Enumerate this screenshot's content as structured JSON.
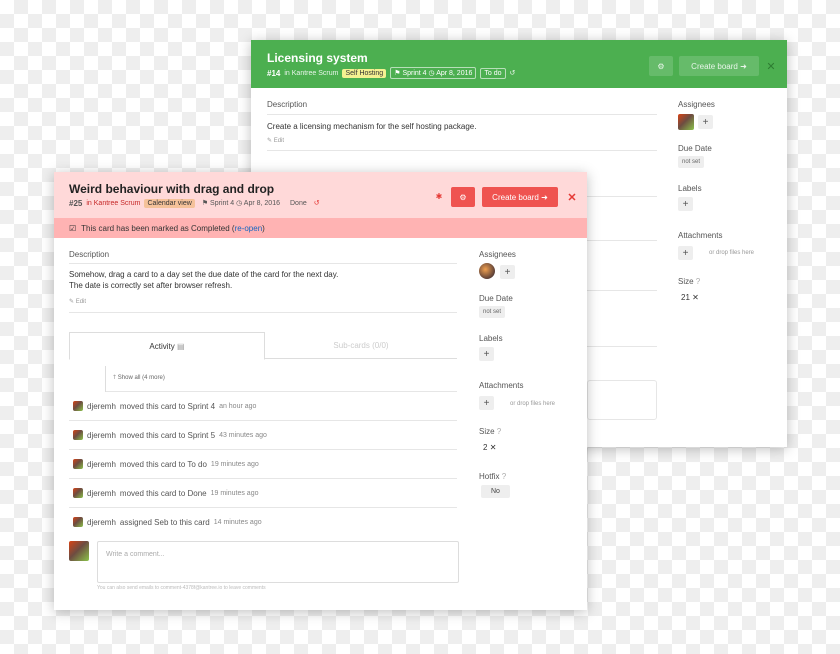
{
  "back_card": {
    "title": "Licensing system",
    "number": "#14",
    "in_label": "in Kantree Scrum",
    "tag": "Self Hosting",
    "sprint": "Sprint 4",
    "date": "Apr 8, 2016",
    "status": "To do",
    "create_board_label": "Create board",
    "description_label": "Description",
    "description_text": "Create a licensing mechanism for the self hosting package.",
    "edit_label": "Edit",
    "sidebar": {
      "assignees_label": "Assignees",
      "due_date_label": "Due Date",
      "due_date_value": "not set",
      "labels_label": "Labels",
      "attachments_label": "Attachments",
      "drop_hint": "or drop files here",
      "size_label": "Size",
      "size_value": "21"
    }
  },
  "front_card": {
    "title": "Weird behaviour with drag and drop",
    "number": "#25",
    "in_label": "in Kantree Scrum",
    "tag": "Calendar view",
    "sprint": "Sprint 4",
    "date": "Apr 8, 2016",
    "status": "Done",
    "create_board_label": "Create board",
    "banner_text": "This card has been marked as Completed (",
    "banner_link": "re-open",
    "banner_close": ")",
    "description_label": "Description",
    "description_line1": "Somehow, drag a card to a day set the due date of the card for the next day.",
    "description_line2": "The date is correctly set after browser refresh.",
    "edit_label": "Edit",
    "tabs": {
      "activity": "Activity",
      "subcards": "Sub-cards (0/0)"
    },
    "show_all": "Show all (4 more)",
    "activity": [
      {
        "user": "djeremh",
        "action": "moved this card to Sprint 4",
        "time": "an hour ago"
      },
      {
        "user": "djeremh",
        "action": "moved this card to Sprint 5",
        "time": "43 minutes ago"
      },
      {
        "user": "djeremh",
        "action": "moved this card to To do",
        "time": "19 minutes ago"
      },
      {
        "user": "djeremh",
        "action": "moved this card to Done",
        "time": "19 minutes ago"
      },
      {
        "user": "djeremh",
        "action": "assigned Seb to this card",
        "time": "14 minutes ago"
      }
    ],
    "comment_placeholder": "Write a comment...",
    "comment_hint": "You can also send emails to comment-4378f@kantree.io to leave comments",
    "sidebar": {
      "assignees_label": "Assignees",
      "due_date_label": "Due Date",
      "due_date_value": "not set",
      "labels_label": "Labels",
      "attachments_label": "Attachments",
      "drop_hint": "or drop files here",
      "size_label": "Size",
      "size_value": "2",
      "hotfix_label": "Hotfix",
      "hotfix_value": "No"
    }
  },
  "colors": {
    "back_header": "#4caf50",
    "front_header": "#ffd9d9",
    "banner": "#ffb3b3",
    "danger": "#ef5350"
  }
}
